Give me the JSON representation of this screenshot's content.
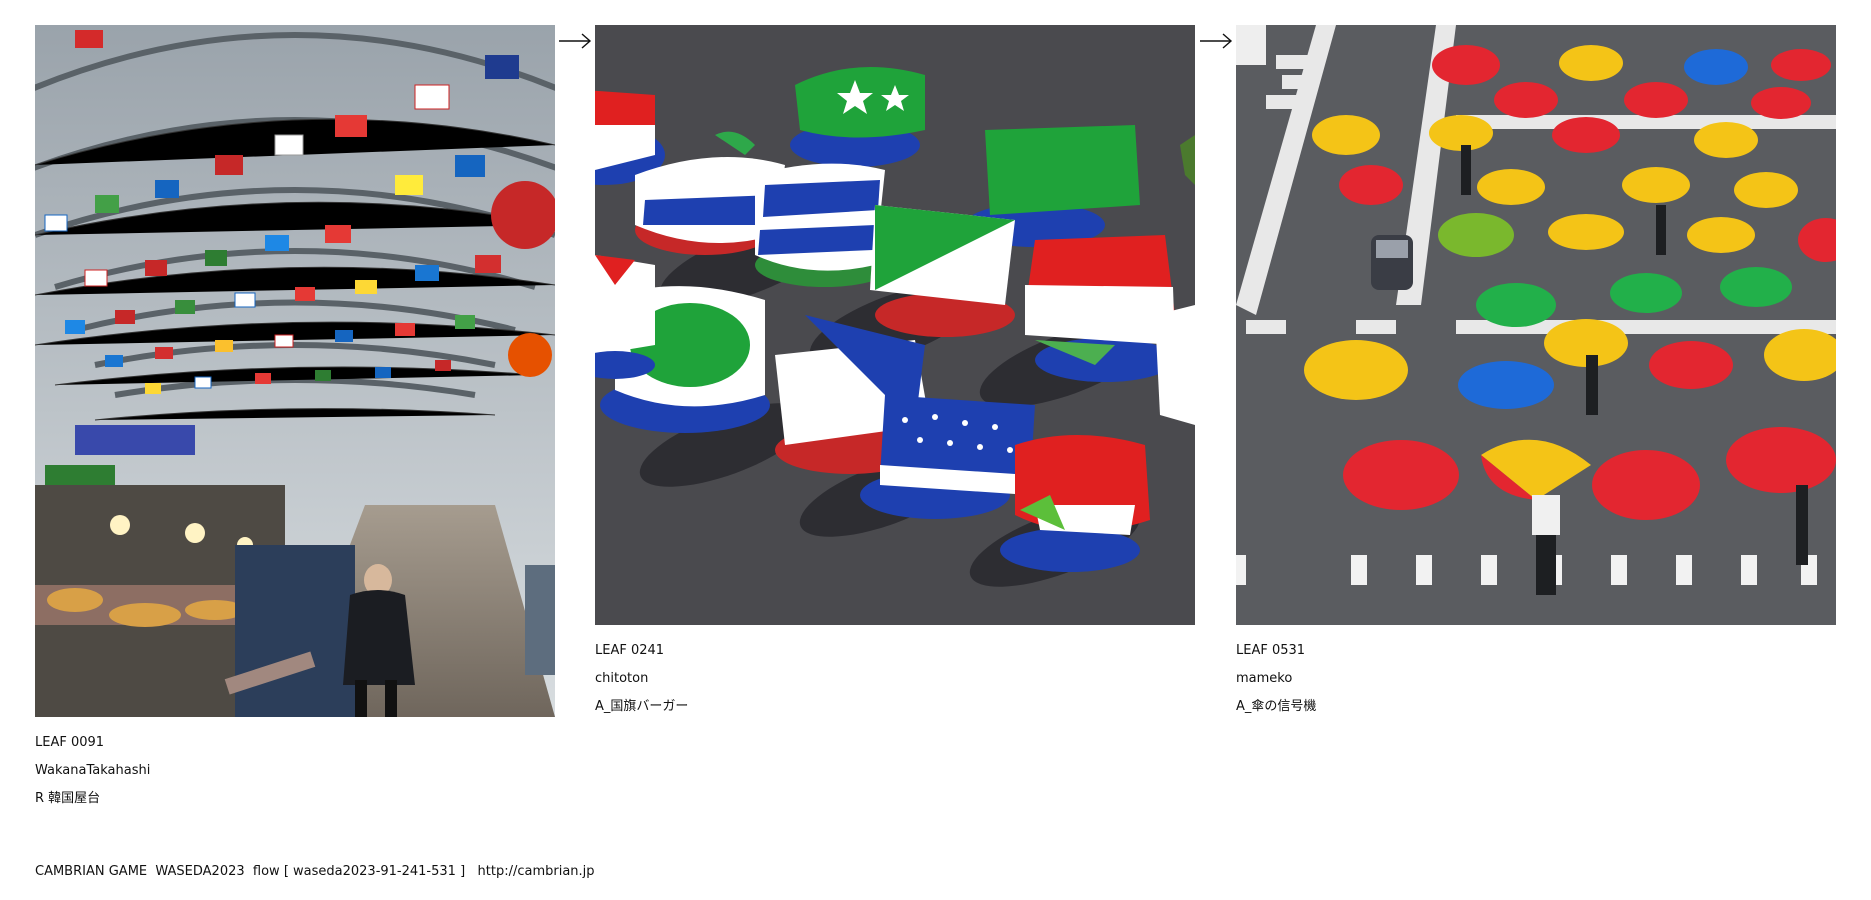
{
  "leaves": [
    {
      "id": "LEAF 0091",
      "author": "WakanaTakahashi",
      "title": "R 韓国屋台",
      "image_alt": "Market arcade hung with world flags"
    },
    {
      "id": "LEAF 0241",
      "author": "chitoton",
      "title": "A_国旗バーガー",
      "image_alt": "Sandwiches wrapped like national flags"
    },
    {
      "id": "LEAF 0531",
      "author": "mameko",
      "title": "A_傘の信号機",
      "image_alt": "Colored umbrellas on a crosswalk"
    }
  ],
  "arrow_icon": "right-arrow",
  "footer": {
    "text": "CAMBRIAN GAME  WASEDA2023  flow [ waseda2023-91-241-531 ]   http://cambrian.jp"
  }
}
